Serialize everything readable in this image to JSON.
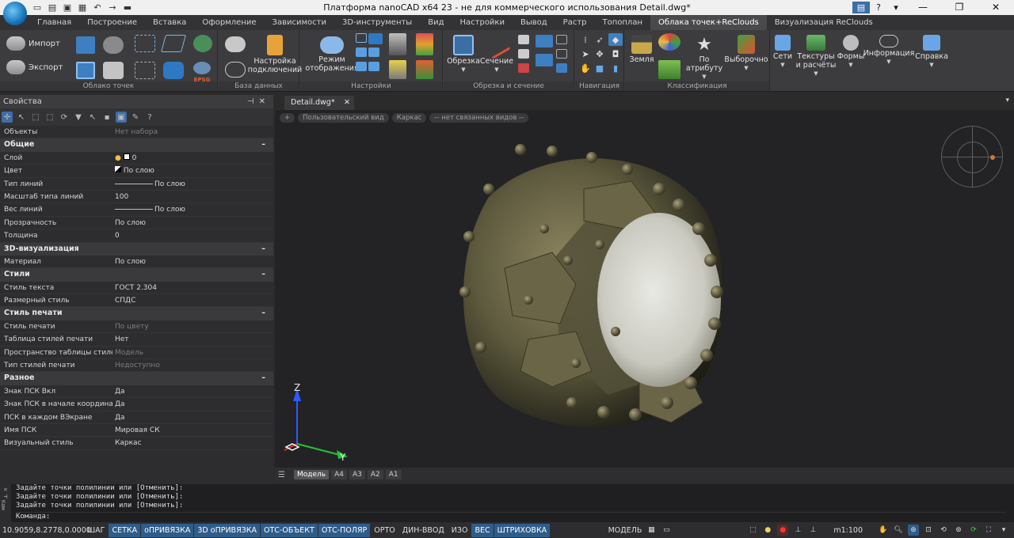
{
  "title_bar": {
    "title": "Платформа nanoCAD x64 23 - не для коммерческого использования Detail.dwg*",
    "help": "?",
    "minimize": "—",
    "maximize": "❐",
    "close": "✕"
  },
  "ribbon_tabs": [
    "Главная",
    "Построение",
    "Вставка",
    "Оформление",
    "Зависимости",
    "3D-инструменты",
    "Вид",
    "Настройки",
    "Вывод",
    "Растр",
    "Топоплан",
    "Облака точек+ReClouds",
    "Визуализация ReClouds"
  ],
  "ribbon": {
    "groups": {
      "point_cloud": "Облако точек",
      "database": "База данных",
      "settings": "Настройки",
      "clip": "Обрезка и сечение",
      "navigation": "Навигация",
      "classification": "Классификация"
    },
    "import": "Импорт",
    "export": "Экспорт",
    "epsg": "EPSG",
    "connection_settings": "Настройка подключений",
    "display_mode": "Режим отображения",
    "clip": "Обрезка",
    "section": "Сечение",
    "ground": "Земля",
    "by_attribute": "По атрибуту",
    "selective": "Выборочно",
    "networks": "Сети",
    "textures": "Текстуры и расчёты",
    "shapes": "Формы",
    "information": "Информация",
    "help": "Справка"
  },
  "properties": {
    "header": "Свойства",
    "objects_label": "Объекты",
    "objects_value": "Нет набора",
    "sections": {
      "general": "Общие",
      "viz3d": "3D-визуализация",
      "styles": "Стили",
      "print_style": "Стиль печати",
      "misc": "Разное"
    },
    "rows": {
      "layer": {
        "k": "Слой",
        "v": "0"
      },
      "color": {
        "k": "Цвет",
        "v": "По слою"
      },
      "linetype": {
        "k": "Тип линий",
        "v": "По слою"
      },
      "linescale": {
        "k": "Масштаб типа линий",
        "v": "100"
      },
      "lineweight": {
        "k": "Вес линий",
        "v": "По слою"
      },
      "transparency": {
        "k": "Прозрачность",
        "v": "По слою"
      },
      "thickness": {
        "k": "Толщина",
        "v": "0"
      },
      "material": {
        "k": "Материал",
        "v": "По слою"
      },
      "text_style": {
        "k": "Стиль текста",
        "v": "ГОСТ 2.304"
      },
      "dim_style": {
        "k": "Размерный стиль",
        "v": "СПДС"
      },
      "plot_style": {
        "k": "Стиль печати",
        "v": "По цвету"
      },
      "plot_table": {
        "k": "Таблица стилей печати",
        "v": "Нет"
      },
      "plot_space": {
        "k": "Пространство таблицы стилей п...",
        "v": "Модель"
      },
      "plot_type": {
        "k": "Тип стилей печати",
        "v": "Недоступно"
      },
      "ucs_on": {
        "k": "Знак ПСК Вкл",
        "v": "Да"
      },
      "ucs_origin": {
        "k": "Знак ПСК в начале координат",
        "v": "Да"
      },
      "ucs_each": {
        "k": "ПСК в каждом ВЭкране",
        "v": "Да"
      },
      "ucs_name": {
        "k": "Имя ПСК",
        "v": "Мировая СК"
      },
      "visual_style": {
        "k": "Визуальный стиль",
        "v": "Каркас"
      }
    }
  },
  "document": {
    "tab": "Detail.dwg*",
    "view_plus": "+",
    "view_name": "Пользовательский вид",
    "visual_style": "Каркас",
    "linked_views": "-- нет связанных видов --",
    "axis_z": "Z",
    "axis_y": "Y"
  },
  "layouts": [
    "Модель",
    "A4",
    "A3",
    "A2",
    "A1"
  ],
  "command": {
    "side_label": "Ком",
    "lines": [
      "Задайте точки полилинии или [Отменить]:",
      "Задайте точки полилинии или [Отменить]:",
      "Задайте точки полилинии или [Отменить]:"
    ],
    "prompt": "Команда:"
  },
  "status": {
    "coords": "10.9059,8.2778,0.0000",
    "buttons": [
      {
        "label": "ШАГ",
        "on": false
      },
      {
        "label": "СЕТКА",
        "on": true
      },
      {
        "label": "оПРИВЯЗКА",
        "on": true
      },
      {
        "label": "3D оПРИВЯЗКА",
        "on": true
      },
      {
        "label": "ОТС-ОБЪЕКТ",
        "on": true
      },
      {
        "label": "ОТС-ПОЛЯР",
        "on": true
      },
      {
        "label": "ОРТО",
        "on": false
      },
      {
        "label": "ДИН-ВВОД",
        "on": false
      },
      {
        "label": "ИЗО",
        "on": false
      },
      {
        "label": "ВЕС",
        "on": true
      },
      {
        "label": "ШТРИХОВКА",
        "on": true
      }
    ],
    "model": "МОДЕЛЬ",
    "scale": "m1:100"
  },
  "colors": {
    "accent": "#2f5d8a",
    "active_tab": "#4a4a4d",
    "viewport_bg": "#232325"
  }
}
